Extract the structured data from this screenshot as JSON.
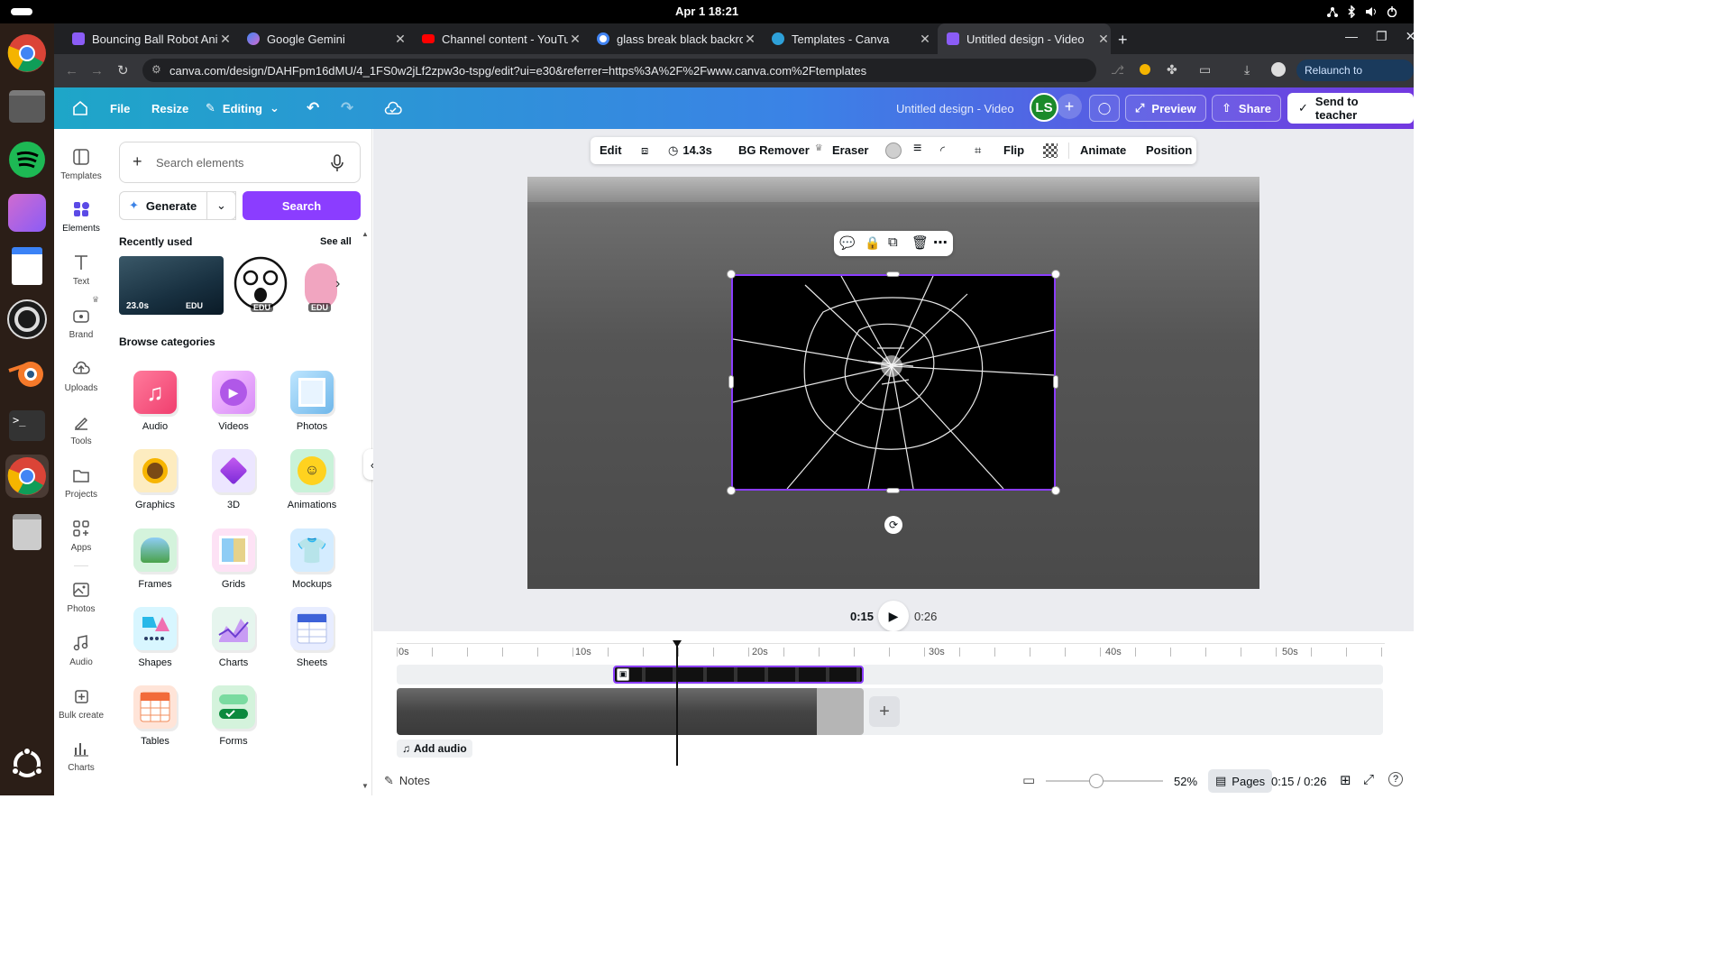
{
  "system": {
    "clock": "Apr 1  18:21"
  },
  "browser": {
    "tabs": [
      {
        "title": "Bouncing Ball Robot Ani",
        "icon": "canva-icon"
      },
      {
        "title": "Google Gemini",
        "icon": "gemini-icon"
      },
      {
        "title": "Channel content - YouTu",
        "icon": "youtube-icon"
      },
      {
        "title": "glass break black backro",
        "icon": "google-icon"
      },
      {
        "title": "Templates - Canva",
        "icon": "canva-icon"
      },
      {
        "title": "Untitled design - Video",
        "icon": "canva-icon"
      }
    ],
    "url": "canva.com/design/DAHFpm16dMU/4_1FS0w2jLf2zpw3o-tspg/edit?ui=e30&referrer=https%3A%2F%2Fwww.canva.com%2Ftemplates",
    "relaunch": "Relaunch to update"
  },
  "header": {
    "file": "File",
    "resize": "Resize",
    "editing": "Editing",
    "design_title": "Untitled design - Video",
    "avatar": "LS",
    "preview": "Preview",
    "share": "Share",
    "send": "Send to teacher"
  },
  "rail": [
    {
      "label": "Templates",
      "icon": "templates-icon"
    },
    {
      "label": "Elements",
      "icon": "elements-icon"
    },
    {
      "label": "Text",
      "icon": "text-icon"
    },
    {
      "label": "Brand",
      "icon": "brand-icon"
    },
    {
      "label": "Uploads",
      "icon": "uploads-icon"
    },
    {
      "label": "Tools",
      "icon": "tools-icon"
    },
    {
      "label": "Projects",
      "icon": "projects-icon"
    },
    {
      "label": "Apps",
      "icon": "apps-icon"
    },
    {
      "label": "Photos",
      "icon": "photos-icon"
    },
    {
      "label": "Audio",
      "icon": "audio-icon"
    },
    {
      "label": "Bulk create",
      "icon": "bulk-create-icon"
    },
    {
      "label": "Charts",
      "icon": "charts-icon"
    }
  ],
  "panel": {
    "search_placeholder": "Search elements",
    "generate": "Generate",
    "search": "Search",
    "recent_title": "Recently used",
    "see_all": "See all",
    "recent": [
      {
        "duration": "23.0s",
        "badge": "EDU"
      },
      {
        "badge": "EDU"
      },
      {
        "badge": "EDU"
      }
    ],
    "browse_title": "Browse categories",
    "categories": [
      "Audio",
      "Videos",
      "Photos",
      "Graphics",
      "3D",
      "Animations",
      "Frames",
      "Grids",
      "Mockups",
      "Shapes",
      "Charts",
      "Sheets",
      "Tables",
      "Forms"
    ]
  },
  "toolbar": {
    "edit": "Edit",
    "duration": "14.3s",
    "bg_remover": "BG Remover",
    "eraser": "Eraser",
    "flip": "Flip",
    "animate": "Animate",
    "position": "Position"
  },
  "playback": {
    "current": "0:15",
    "total": "0:26"
  },
  "timeline": {
    "ticks": [
      "0s",
      "10s",
      "20s",
      "30s",
      "40s",
      "50s"
    ],
    "add_audio": "Add audio"
  },
  "footer": {
    "notes": "Notes",
    "zoom": "52%",
    "pages": "Pages",
    "time": "0:15 / 0:26"
  },
  "colors": {
    "accent": "#8b3dff",
    "header_start": "#1ea6c8",
    "header_end": "#7338e0"
  }
}
